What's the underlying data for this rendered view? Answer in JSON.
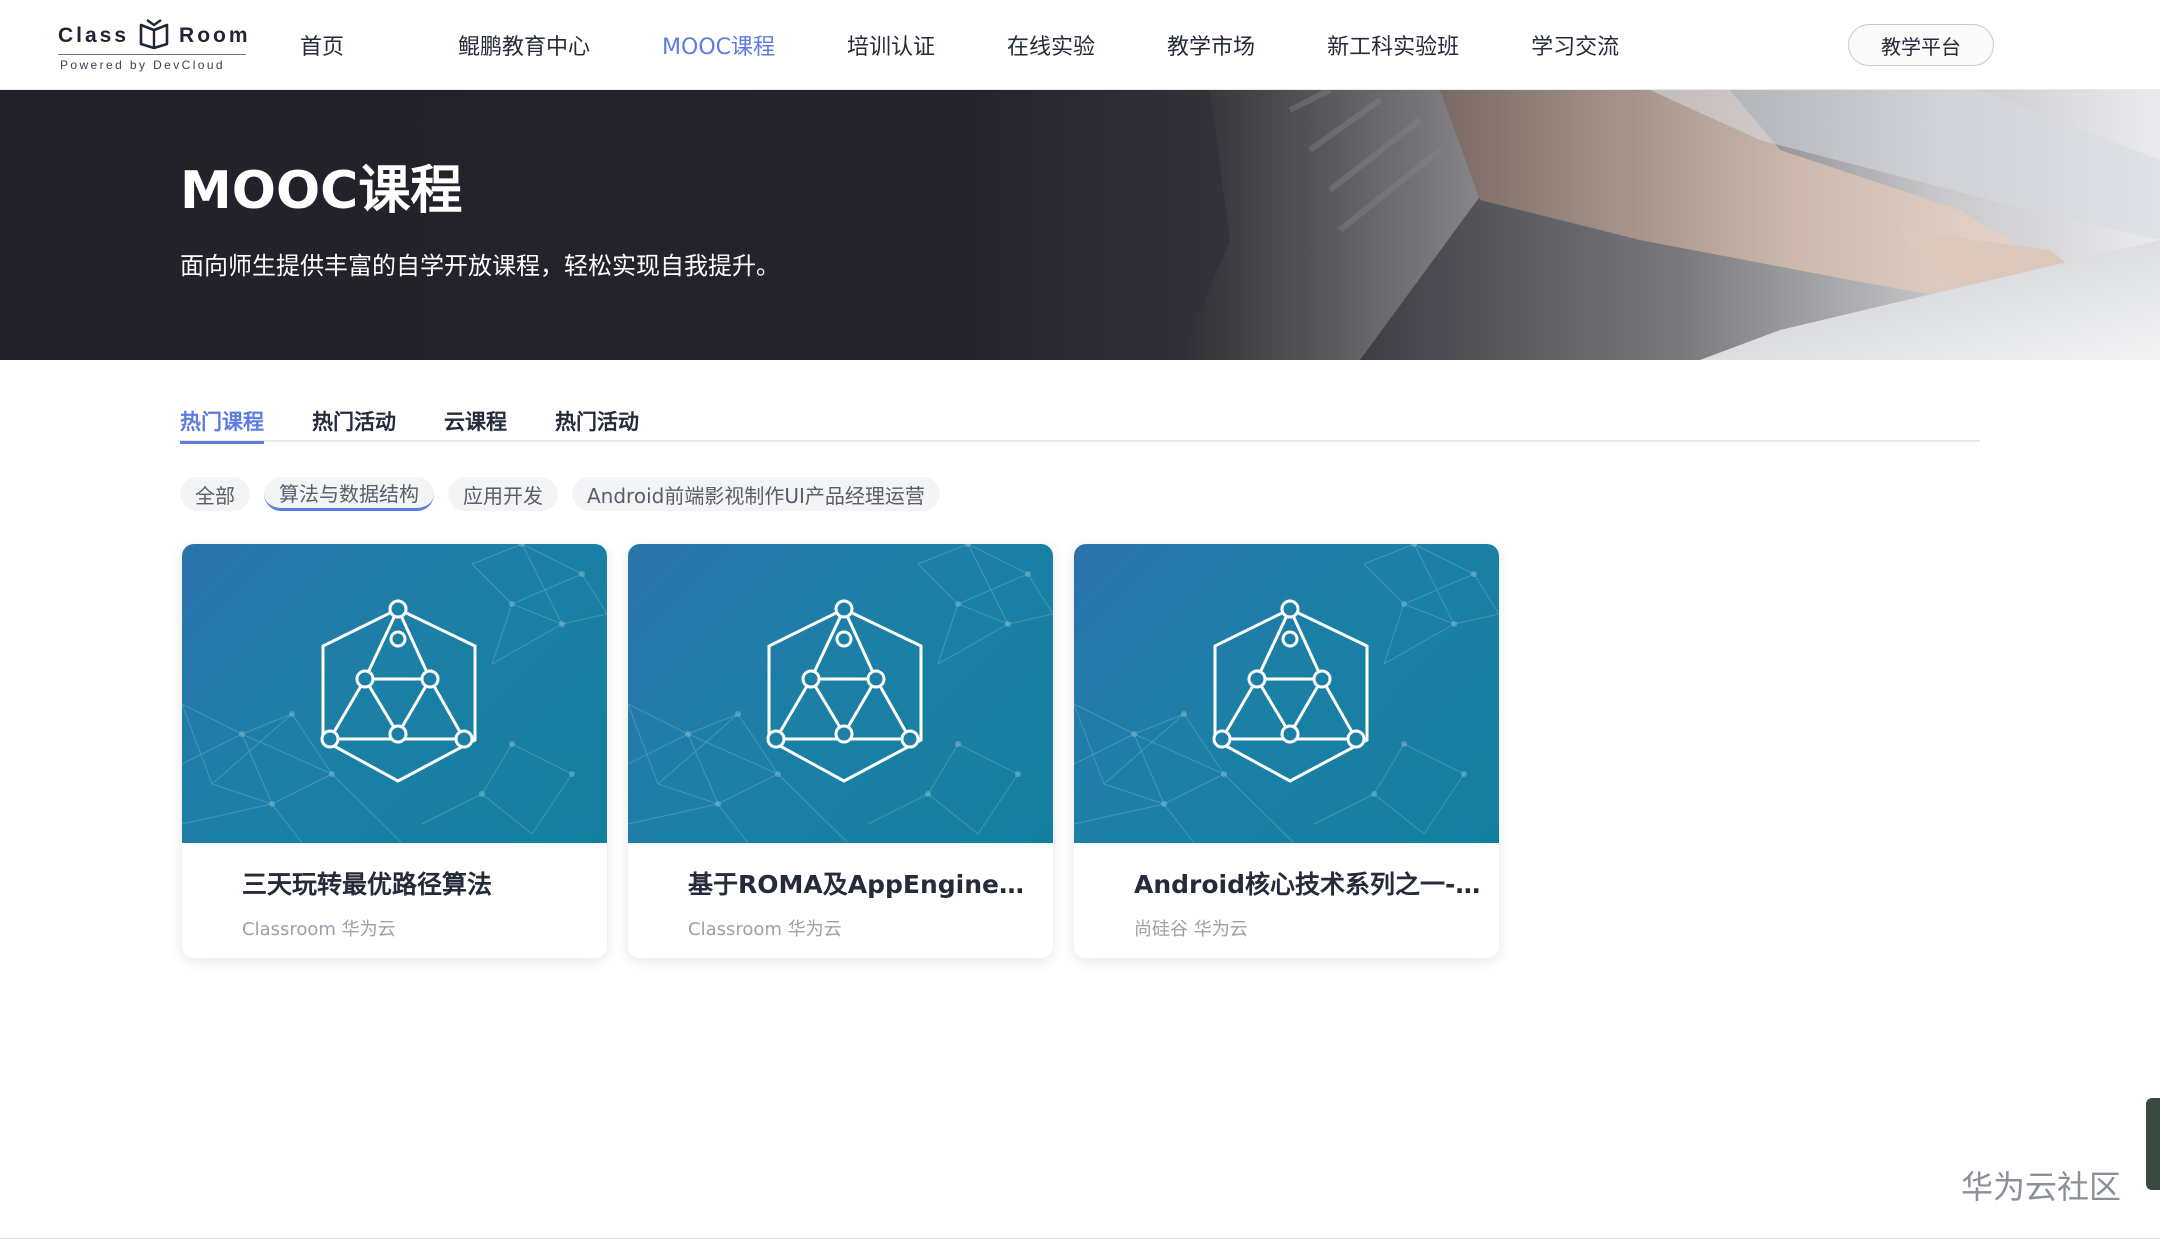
{
  "logo": {
    "left_text": "Class",
    "right_text": "Room",
    "sub_text": "Powered by DevCloud"
  },
  "nav": {
    "items": [
      "首页",
      "鲲鹏教育中心",
      "MOOC课程",
      "培训认证",
      "在线实验",
      "教学市场",
      "新工科实验班",
      "学习交流"
    ],
    "active_index": 2,
    "platform_button": "教学平台"
  },
  "banner": {
    "title": "MOOC课程",
    "subtitle": "面向师生提供丰富的自学开放课程，轻松实现自我提升。"
  },
  "tabs": {
    "items": [
      "热门课程",
      "热门活动",
      "云课程",
      "热门活动"
    ],
    "active_index": 0
  },
  "filters": {
    "items": [
      "全部",
      "算法与数据结构",
      "应用开发",
      "Android前端影视制作UI产品经理运营"
    ],
    "active_index": 1
  },
  "courses": [
    {
      "title": "三天玩转最优路径算法",
      "meta": "Classroom 华为云"
    },
    {
      "title": "基于ROMA及AppEngine告警通知系统开发",
      "meta": "Classroom 华为云"
    },
    {
      "title": "Android核心技术系列之一-初识Android",
      "meta": "尚硅谷 华为云"
    }
  ],
  "watermark": "华为云社区",
  "colors": {
    "accent": "#5e7ce0",
    "text": "#252b3a",
    "cover_start": "#2b73ad",
    "cover_end": "#137f9f"
  }
}
